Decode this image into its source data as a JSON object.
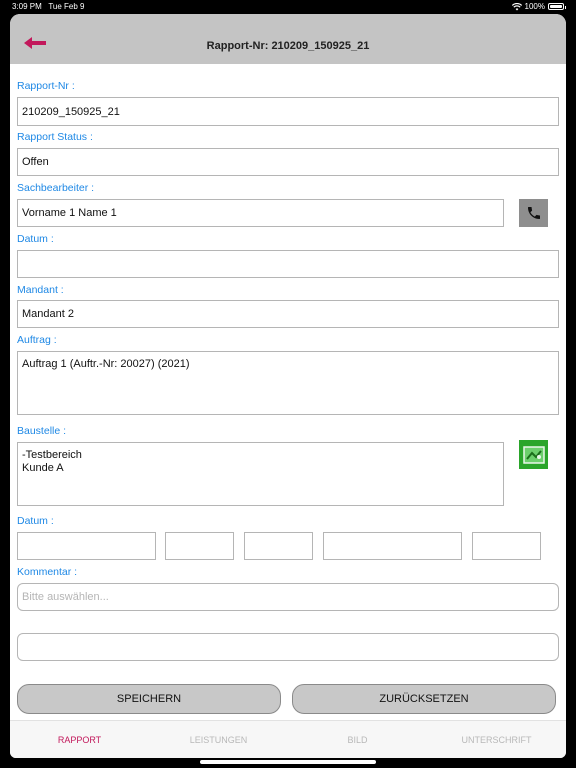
{
  "status_bar": {
    "time": "3:09 PM",
    "date": "Tue Feb 9",
    "battery": "100%"
  },
  "header": {
    "title": "Rapport-Nr: 210209_150925_21"
  },
  "form": {
    "rapport_nr": {
      "label": "Rapport-Nr :",
      "value": "210209_150925_21"
    },
    "status": {
      "label": "Rapport Status :",
      "value": "Offen"
    },
    "sachbearbeiter": {
      "label": "Sachbearbeiter :",
      "value": "Vorname 1 Name 1"
    },
    "datum": {
      "label": "Datum :",
      "value": ""
    },
    "mandant": {
      "label": "Mandant :",
      "value": "Mandant 2"
    },
    "auftrag": {
      "label": "Auftrag :",
      "value": "Auftrag 1  (Auftr.-Nr: 20027) (2021)"
    },
    "baustelle": {
      "label": "Baustelle :",
      "value": "-Testbereich\nKunde A"
    },
    "datum2": {
      "label": "Datum :"
    },
    "kommentar": {
      "label": "Kommentar :",
      "placeholder": "Bitte auswählen...",
      "value": ""
    }
  },
  "buttons": {
    "save": "SPEICHERN",
    "reset": "ZURÜCKSETZEN"
  },
  "tabs": [
    {
      "label": "RAPPORT",
      "active": true
    },
    {
      "label": "LEISTUNGEN",
      "active": false
    },
    {
      "label": "BILD",
      "active": false
    },
    {
      "label": "UNTERSCHRIFT",
      "active": false
    }
  ],
  "colors": {
    "accent": "#c2185b",
    "label_blue": "#1e88e5",
    "map_green": "#2aa52a"
  }
}
